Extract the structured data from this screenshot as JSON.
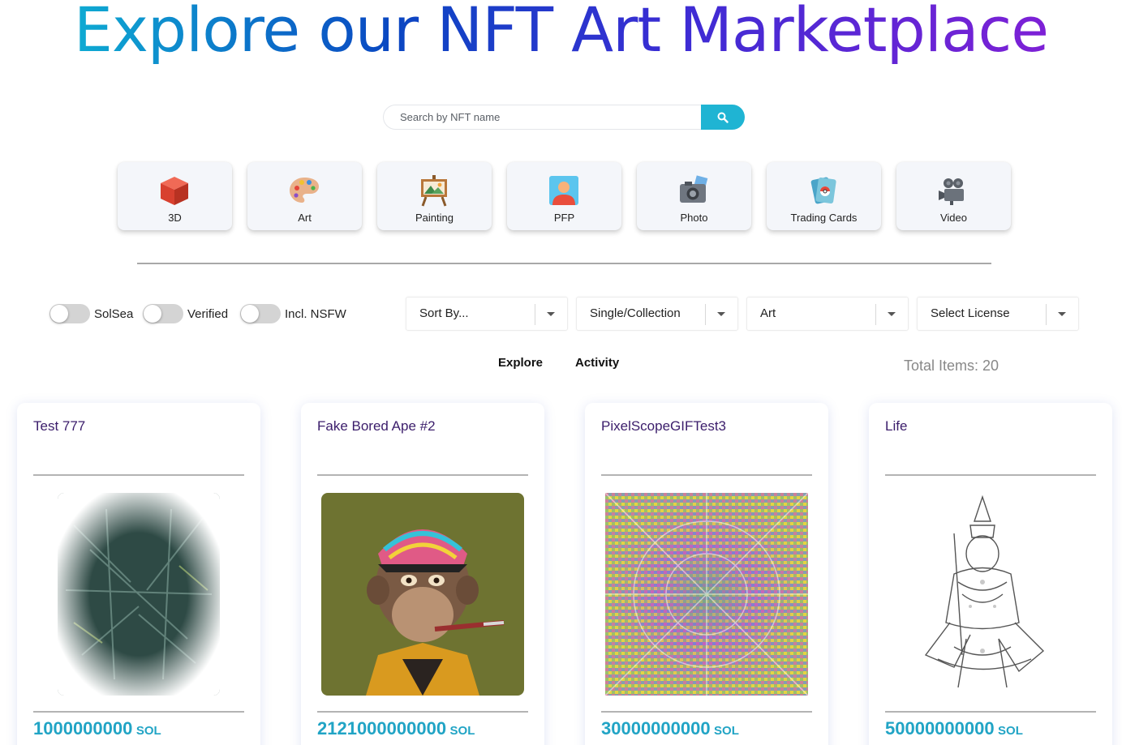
{
  "hero": {
    "title": "Explore our NFT Art Marketplace"
  },
  "search": {
    "placeholder": "Search by NFT name"
  },
  "categories": [
    {
      "label": "3D",
      "icon": "cube-icon"
    },
    {
      "label": "Art",
      "icon": "palette-icon"
    },
    {
      "label": "Painting",
      "icon": "easel-icon"
    },
    {
      "label": "PFP",
      "icon": "profile-icon"
    },
    {
      "label": "Photo",
      "icon": "camera-icon"
    },
    {
      "label": "Trading Cards",
      "icon": "cards-icon"
    },
    {
      "label": "Video",
      "icon": "video-camera-icon"
    }
  ],
  "filters": {
    "toggles": [
      {
        "label": "SolSea",
        "on": false
      },
      {
        "label": "Verified",
        "on": false
      },
      {
        "label": "Incl. NSFW",
        "on": false
      }
    ],
    "selects": [
      {
        "value": "Sort By..."
      },
      {
        "value": "Single/Collection"
      },
      {
        "value": "Art"
      },
      {
        "value": "Select License"
      }
    ]
  },
  "tabs": {
    "explore": "Explore",
    "activity": "Activity"
  },
  "total": "Total Items: 20",
  "cards": [
    {
      "title": "Test 777",
      "price": "1000000000",
      "currency": "SOL"
    },
    {
      "title": "Fake Bored Ape #2",
      "price": "2121000000000",
      "currency": "SOL"
    },
    {
      "title": "PixelScopeGIFTest3",
      "price": "30000000000",
      "currency": "SOL"
    },
    {
      "title": "Life",
      "price": "50000000000",
      "currency": "SOL"
    }
  ],
  "colors": {
    "accent": "#1fb4d3",
    "price": "#21a4c5",
    "title": "#3b1d6b"
  }
}
